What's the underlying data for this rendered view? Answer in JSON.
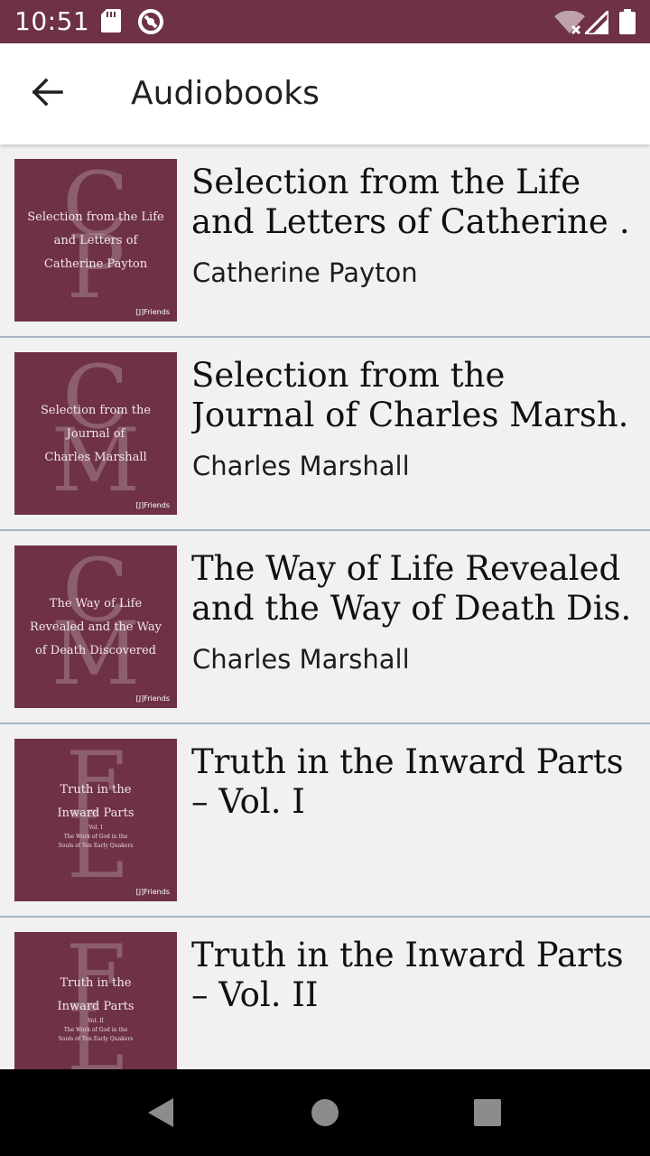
{
  "status_bar": {
    "time": "10:51",
    "icons": [
      "sd-card-icon",
      "sync-icon",
      "wifi-icon",
      "signal-icon",
      "battery-icon"
    ]
  },
  "app_bar": {
    "title": "Audiobooks",
    "back_icon": "arrow-back-icon"
  },
  "books": [
    {
      "title_line1": "Selection from the Life",
      "title_line2": "and Letters of Catherine …",
      "author": "Catherine Payton",
      "cover": {
        "monogram": [
          "C",
          "P"
        ],
        "lines": [
          "Selection from the Life",
          "and Letters of",
          "Catherine Payton"
        ],
        "sub": []
      }
    },
    {
      "title_line1": "Selection from the",
      "title_line2": "Journal of Charles Marsh..",
      "author": "Charles Marshall",
      "cover": {
        "monogram": [
          "C",
          "M"
        ],
        "lines": [
          "Selection from the",
          "Journal of",
          "Charles Marshall"
        ],
        "sub": []
      }
    },
    {
      "title_line1": "The Way of Life Revealed",
      "title_line2": "and the Way of Death Dis..",
      "author": "Charles Marshall",
      "cover": {
        "monogram": [
          "C",
          "M"
        ],
        "lines": [
          "The Way of Life",
          "Revealed and the Way",
          "of Death Discovered"
        ],
        "sub": []
      }
    },
    {
      "title_line1": "Truth in the Inward Parts",
      "title_line2": "– Vol. I",
      "author": "",
      "cover": {
        "monogram": [
          "F",
          "L"
        ],
        "lines": [
          "Truth in the",
          "Inward Parts"
        ],
        "sub": [
          "Vol. I",
          "The Work of God in the",
          "Souls of Ten Early Quakers"
        ]
      }
    },
    {
      "title_line1": "Truth in the Inward Parts",
      "title_line2": "– Vol. II",
      "author": "",
      "cover": {
        "monogram": [
          "F",
          "L"
        ],
        "lines": [
          "Truth in the",
          "Inward Parts"
        ],
        "sub": [
          "Vol. II",
          "The Work of God in the",
          "Souls of Ten Early Quakers"
        ]
      }
    }
  ],
  "cover_logo_text": "[J]Friends",
  "nav_bar": {
    "icons": [
      "nav-back-icon",
      "nav-home-icon",
      "nav-recents-icon"
    ]
  },
  "colors": {
    "brand": "#6e3244",
    "divider": "#a9b4c6",
    "background": "#f1f1f1"
  }
}
